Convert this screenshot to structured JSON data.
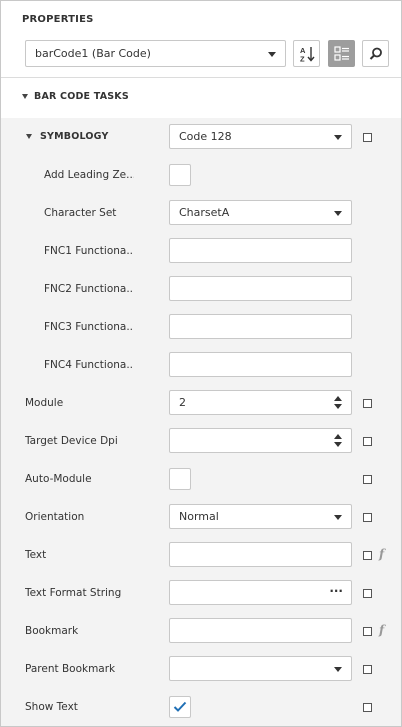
{
  "panel": {
    "title": "PROPERTIES",
    "component_selector": {
      "value": "barCode1 (Bar Code)"
    },
    "toolbar": {
      "sort_icon": "sort-alphabetical-icon",
      "categories_icon": "categorized-view-icon",
      "search_icon": "search-icon"
    }
  },
  "tasks": {
    "title": "BAR CODE TASKS",
    "symbology": {
      "label": "SYMBOLOGY",
      "value": "Code 128"
    },
    "sub": [
      {
        "label": "Add Leading Ze..."
      },
      {
        "label": "Character Set",
        "value": "CharsetA"
      },
      {
        "label": "FNC1 Functiona...",
        "value": ""
      },
      {
        "label": "FNC2 Functiona...",
        "value": ""
      },
      {
        "label": "FNC3 Functiona...",
        "value": ""
      },
      {
        "label": "FNC4 Functiona...",
        "value": ""
      }
    ],
    "props": [
      {
        "label": "Module",
        "value": "2"
      },
      {
        "label": "Target Device Dpi",
        "value": ""
      },
      {
        "label": "Auto-Module"
      },
      {
        "label": "Orientation",
        "value": "Normal"
      },
      {
        "label": "Text",
        "value": ""
      },
      {
        "label": "Text Format String",
        "value": "",
        "button": "···"
      },
      {
        "label": "Bookmark",
        "value": ""
      },
      {
        "label": "Parent Bookmark",
        "value": ""
      },
      {
        "label": "Show Text",
        "checked": true
      }
    ]
  },
  "colors": {
    "checkmark": "#1f6fb5",
    "active_button": "#9d9d9d",
    "grid_background": "#f3f3f3"
  }
}
